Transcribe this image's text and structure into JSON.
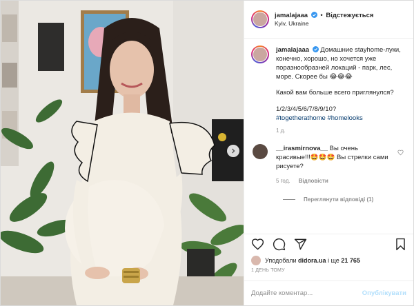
{
  "account": {
    "username": "jamalajaaa",
    "follow_state": "Відстежується",
    "location": "Kyiv, Ukraine"
  },
  "caption": {
    "text": "Домашние stayhome-луки, конечно, хорошо, но хочется уже поразнообразней локаций - парк, лес, море. Скорее бы 😂😂😂",
    "question": "Какой вам больше всего приглянулся?",
    "options": "1/2/3/4/5/6/7/8/9/10?",
    "hashtags": [
      "#togetherathome",
      "#homelooks"
    ],
    "age": "1 д."
  },
  "comment": {
    "username": "__irasmirnova__",
    "text": "Вы очень красивые!!!🤩🤩🤩 Вы стрелки сами рисуете?",
    "age": "5 год.",
    "reply_label": "Відповісти",
    "view_replies": "Переглянути відповіді (1)"
  },
  "likes": {
    "prefix": "Уподобали ",
    "user": "didora.ua",
    "joiner": " і ще ",
    "count": "21 765"
  },
  "posted_ago": "1 ДЕНЬ ТОМУ",
  "compose": {
    "placeholder": "Додайте коментар...",
    "post_label": "Опублікувати"
  },
  "colors": {
    "link": "#00376b",
    "verified": "#3897f0",
    "post_disabled": "#b2dffc",
    "muted": "#8e8e8e"
  },
  "icons": [
    "verified-icon",
    "chevron-right-icon",
    "heart-icon",
    "comment-icon",
    "share-icon",
    "bookmark-icon"
  ]
}
